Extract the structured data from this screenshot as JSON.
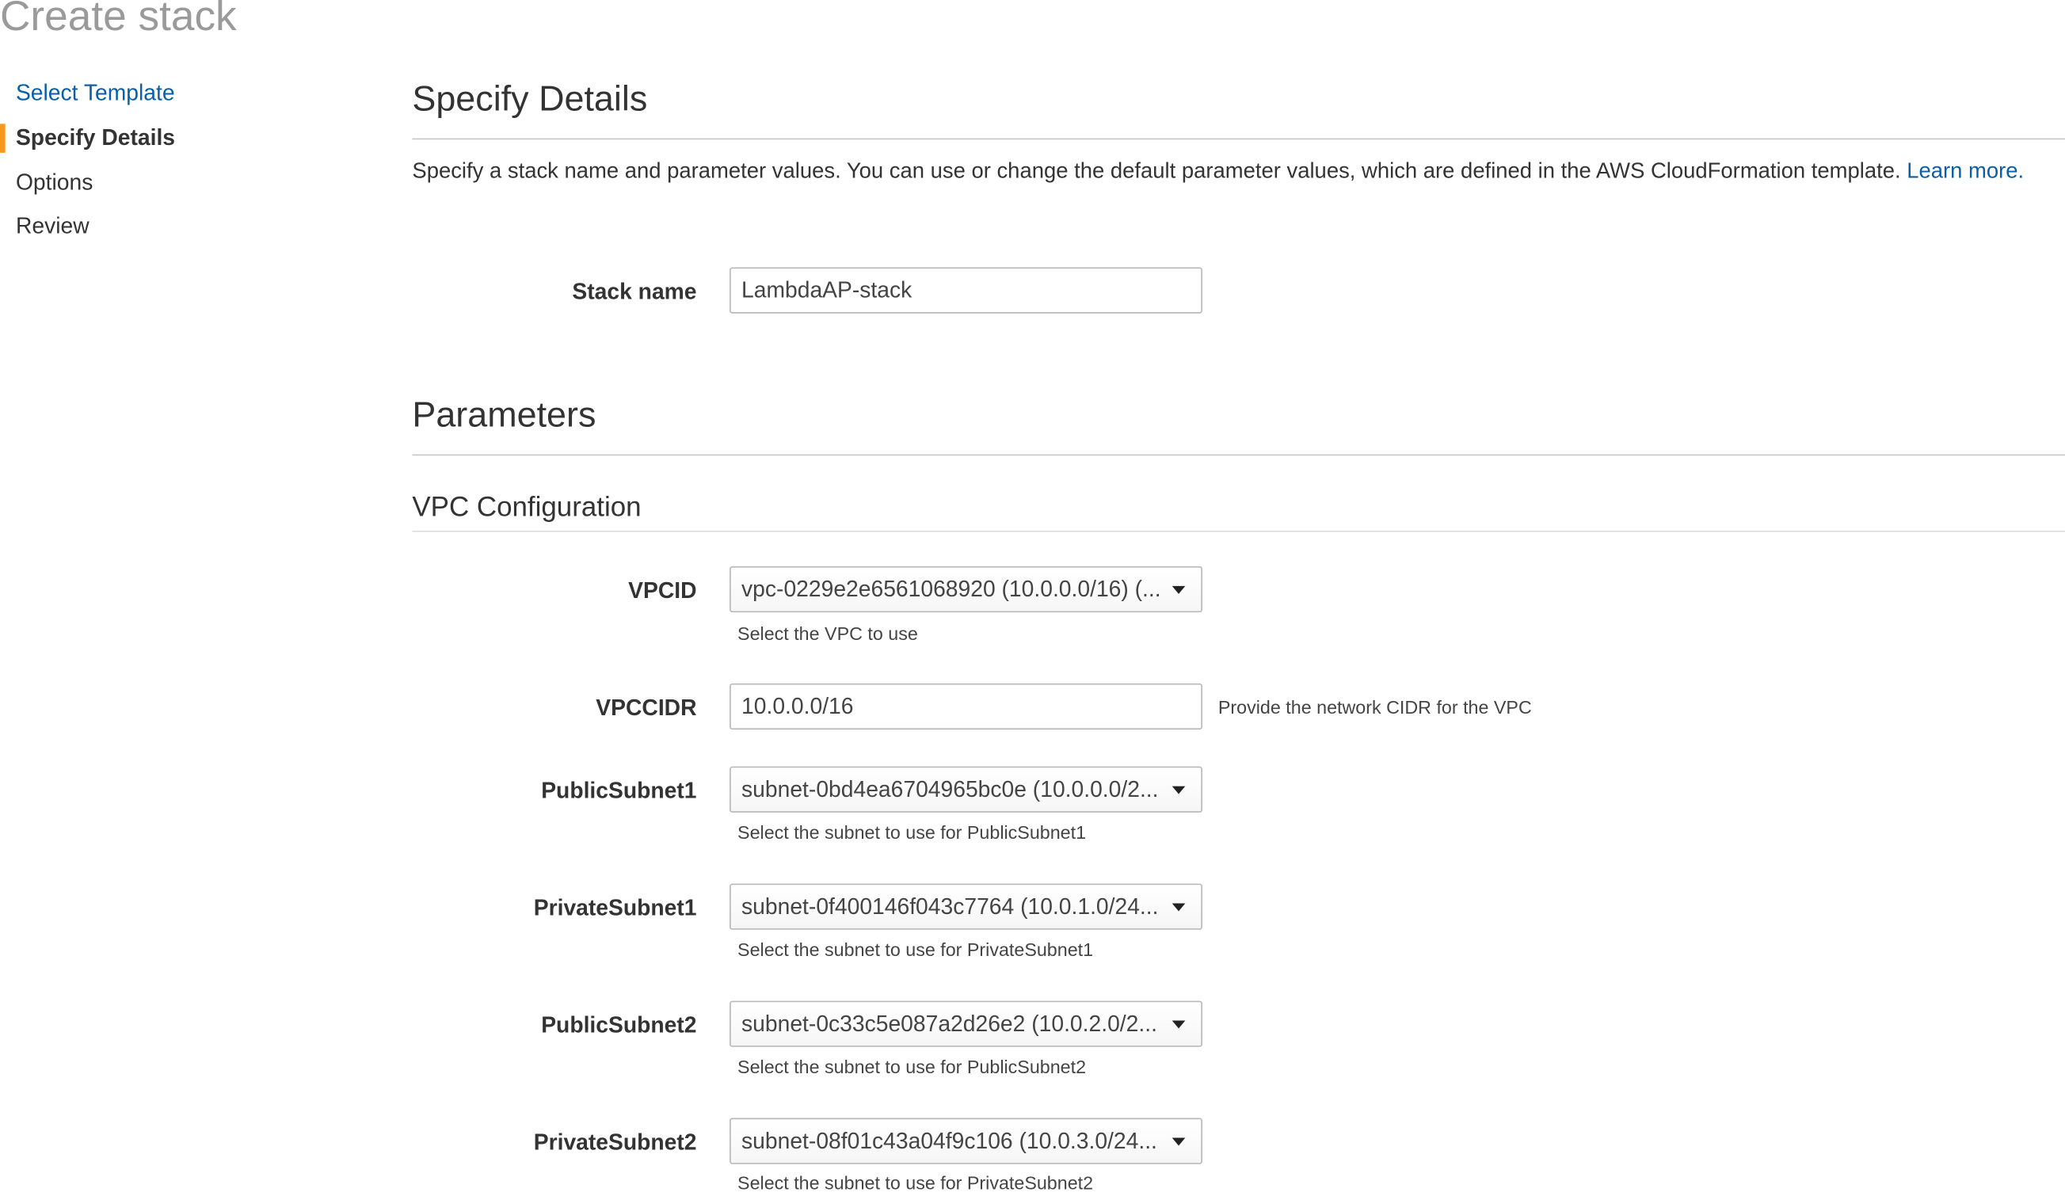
{
  "page": {
    "title": "Create stack"
  },
  "steps": [
    {
      "label": "Select Template",
      "state": "link"
    },
    {
      "label": "Specify Details",
      "state": "active"
    },
    {
      "label": "Options",
      "state": "upcoming"
    },
    {
      "label": "Review",
      "state": "upcoming"
    }
  ],
  "details": {
    "heading": "Specify Details",
    "description": "Specify a stack name and parameter values. You can use or change the default parameter values, which are defined in the AWS CloudFormation template.",
    "learn_more": "Learn more.",
    "stack_name_label": "Stack name",
    "stack_name_value": "LambdaAP-stack"
  },
  "parameters": {
    "heading": "Parameters",
    "group_heading": "VPC Configuration",
    "vpcid": {
      "label": "VPCID",
      "value": "vpc-0229e2e6561068920 (10.0.0.0/16) (...",
      "help": "Select the VPC to use"
    },
    "vpccidr": {
      "label": "VPCCIDR",
      "value": "10.0.0.0/16",
      "help": "Provide the network CIDR for the VPC"
    },
    "public_subnet1": {
      "label": "PublicSubnet1",
      "value": "subnet-0bd4ea6704965bc0e (10.0.0.0/2...",
      "help": "Select the subnet to use for PublicSubnet1"
    },
    "private_subnet1": {
      "label": "PrivateSubnet1",
      "value": "subnet-0f400146f043c7764 (10.0.1.0/24...",
      "help": "Select the subnet to use for PrivateSubnet1"
    },
    "public_subnet2": {
      "label": "PublicSubnet2",
      "value": "subnet-0c33c5e087a2d26e2 (10.0.2.0/2...",
      "help": "Select the subnet to use for PublicSubnet2"
    },
    "private_subnet2": {
      "label": "PrivateSubnet2",
      "value": "subnet-08f01c43a04f9c106 (10.0.3.0/24...",
      "help": "Select the subnet to use for PrivateSubnet2"
    }
  },
  "colors": {
    "accent": "#f7981d",
    "link": "#0a5fa8",
    "title_gray": "#9a9a9a"
  },
  "icons": {
    "select_caret": "caret-down-icon"
  }
}
